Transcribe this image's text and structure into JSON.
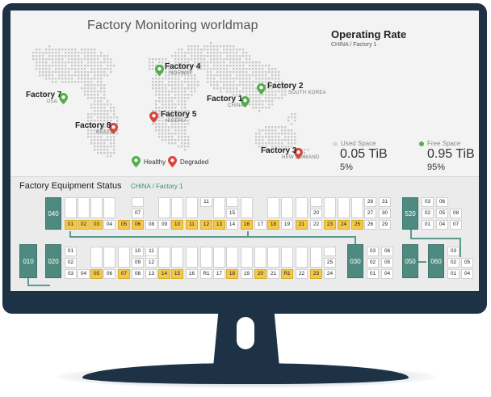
{
  "map": {
    "title": "Factory Monitoring worldmap",
    "factories": [
      {
        "name": "Factory 4",
        "location": "NORWAY",
        "status": "healthy"
      },
      {
        "name": "Factory 2",
        "location": "SOUTH KOREA",
        "status": "healthy"
      },
      {
        "name": "Factory 7",
        "location": "USA",
        "status": "healthy"
      },
      {
        "name": "Factory 1",
        "location": "CHINA",
        "status": "healthy"
      },
      {
        "name": "Factory 5",
        "location": "NIGERIA",
        "status": "degraded"
      },
      {
        "name": "Factory 8",
        "location": "BRAZIL",
        "status": "degraded"
      },
      {
        "name": "Factory 3",
        "location": "NEW ZEALAND",
        "status": "degraded"
      }
    ],
    "legend": {
      "healthy": "Healthy",
      "degraded": "Degraded"
    }
  },
  "colors": {
    "healthy": "#52ae4a",
    "degraded": "#d9443c",
    "tower": "#4f8a80",
    "highlight": "#f3c84b",
    "bezel": "#1e3246"
  },
  "operating": {
    "title": "Operating Rate",
    "country": "CHINA /",
    "factory": "Factory 1",
    "used": {
      "label": "Used Space",
      "value": "0.05 TiB",
      "pct": "5%"
    },
    "free": {
      "label": "Free Space",
      "value": "0.95 TiB",
      "pct": "95%"
    }
  },
  "equipment": {
    "title": "Factory Equipment Status",
    "country": "CHINA /",
    "factory": "Factory 1",
    "towers": [
      "040",
      "020",
      "010",
      "520",
      "030",
      "050",
      "060"
    ],
    "top_block": {
      "row1": [
        "01",
        "02",
        "03",
        "04",
        "05",
        "06",
        "07",
        "08",
        "09",
        "10",
        "11",
        "12",
        "13",
        "14",
        "15",
        "16",
        "17",
        "18",
        "19",
        "21",
        "22",
        "23",
        "24",
        "25",
        "26",
        "29"
      ],
      "row1_yellow": [
        "01",
        "02",
        "03",
        "05",
        "06",
        "10",
        "12",
        "13",
        "16",
        "18",
        "21",
        "23",
        "24",
        "25"
      ],
      "row2": [
        "07",
        "15",
        "20",
        "27",
        "30"
      ],
      "row3": [
        "28",
        "31"
      ],
      "right_col": [
        [
          "03",
          "06"
        ],
        [
          "02",
          "05",
          "08"
        ],
        [
          "01",
          "04",
          "07"
        ]
      ]
    },
    "bottom_block": {
      "left_col": [
        "01",
        "02",
        "03"
      ],
      "row1": [
        "04",
        "05",
        "06",
        "07",
        "08",
        "13",
        "14",
        "15",
        "16",
        "R1",
        "17",
        "18",
        "19",
        "20",
        "21",
        "R1",
        "22",
        "23",
        "24"
      ],
      "row1_yellow": [
        "05",
        "07",
        "14",
        "15",
        "18",
        "20",
        "R1",
        "23"
      ],
      "row2": [
        "09",
        "12",
        "25"
      ],
      "row3": [
        "10",
        "11"
      ],
      "col030": [
        "03",
        "02",
        "01"
      ],
      "col030b": [
        "06",
        "05",
        "04"
      ],
      "col060": [
        "03",
        "02",
        "01"
      ],
      "col060b": [
        "05",
        "04"
      ]
    }
  }
}
